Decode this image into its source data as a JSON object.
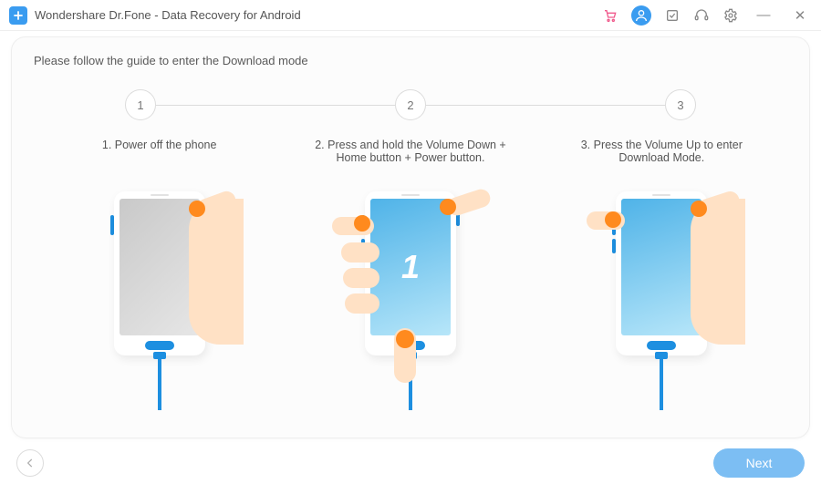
{
  "titlebar": {
    "title": "Wondershare Dr.Fone - Data Recovery for Android",
    "icons": {
      "cart": "cart-icon",
      "account": "account-icon",
      "feedback": "feedback-icon",
      "support": "support-icon",
      "settings": "settings-icon"
    }
  },
  "page": {
    "subtitle": "Please follow the guide to enter the Download mode"
  },
  "stepper": {
    "numbers": [
      "1",
      "2",
      "3"
    ]
  },
  "steps": [
    {
      "caption": "1. Power off the phone",
      "screen": "off"
    },
    {
      "caption": "2. Press and hold the Volume Down + Home button + Power button.",
      "screen": "on",
      "screen_label": "1"
    },
    {
      "caption": "3. Press the Volume Up to enter Download Mode.",
      "screen": "on"
    }
  ],
  "footer": {
    "back_label": "Back",
    "next_label": "Next"
  },
  "colors": {
    "accent": "#3a9cf0",
    "button": "#7cbef3",
    "cable": "#1d8fe0",
    "skin": "#ffe1c5",
    "fingertip": "#ff8a1e"
  }
}
